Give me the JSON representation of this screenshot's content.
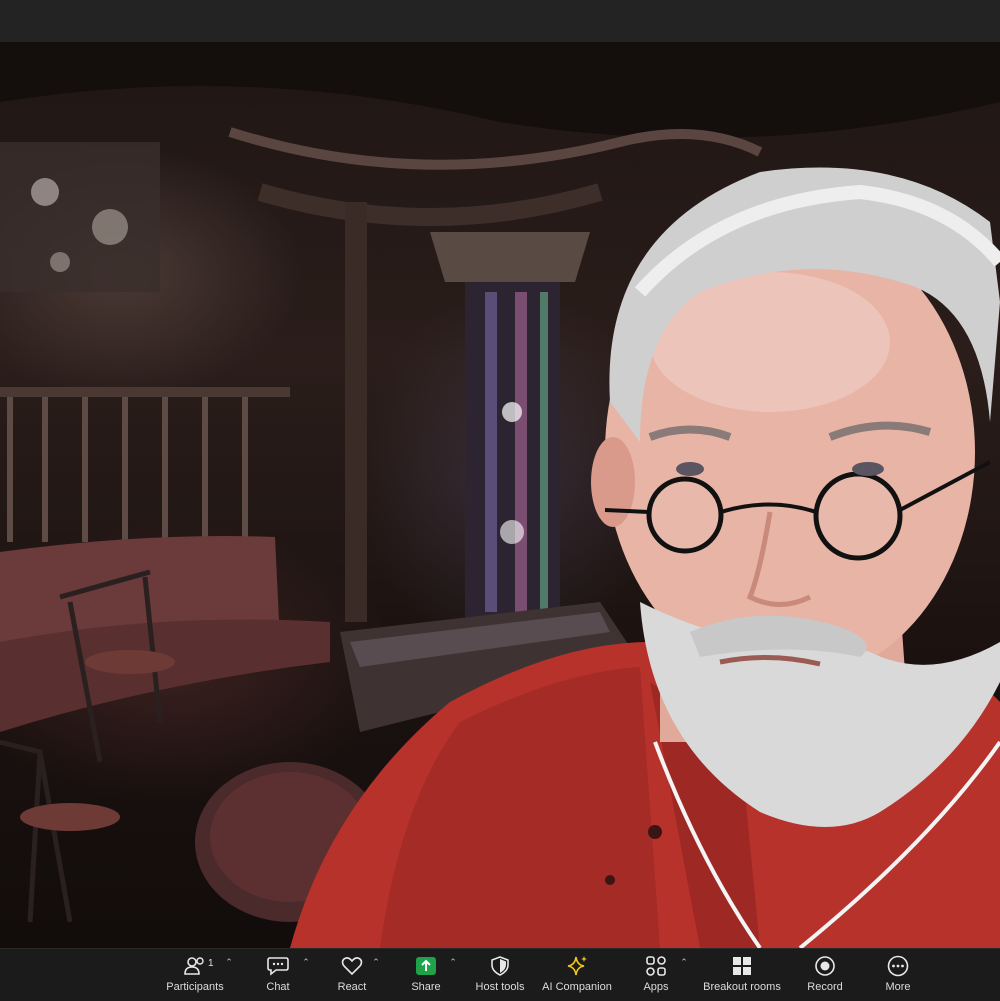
{
  "toolbar": {
    "participants": {
      "label": "Participants",
      "count": "1",
      "icon": "participants-icon"
    },
    "chat": {
      "label": "Chat",
      "icon": "chat-icon"
    },
    "react": {
      "label": "React",
      "icon": "heart-icon"
    },
    "share": {
      "label": "Share",
      "icon": "share-screen-icon",
      "color": "#1fa34a"
    },
    "host_tools": {
      "label": "Host tools",
      "icon": "shield-icon"
    },
    "ai_companion": {
      "label": "AI Companion",
      "icon": "sparkle-icon",
      "color": "#f2c51b"
    },
    "apps": {
      "label": "Apps",
      "icon": "apps-icon"
    },
    "breakout_rooms": {
      "label": "Breakout rooms",
      "icon": "grid-icon"
    },
    "record": {
      "label": "Record",
      "icon": "record-icon"
    },
    "more": {
      "label": "More",
      "icon": "ellipsis-icon"
    }
  },
  "colors": {
    "toolbar_bg": "#1b1b1b",
    "topbar_bg": "#232323",
    "shirt_red": "#b8322c"
  }
}
